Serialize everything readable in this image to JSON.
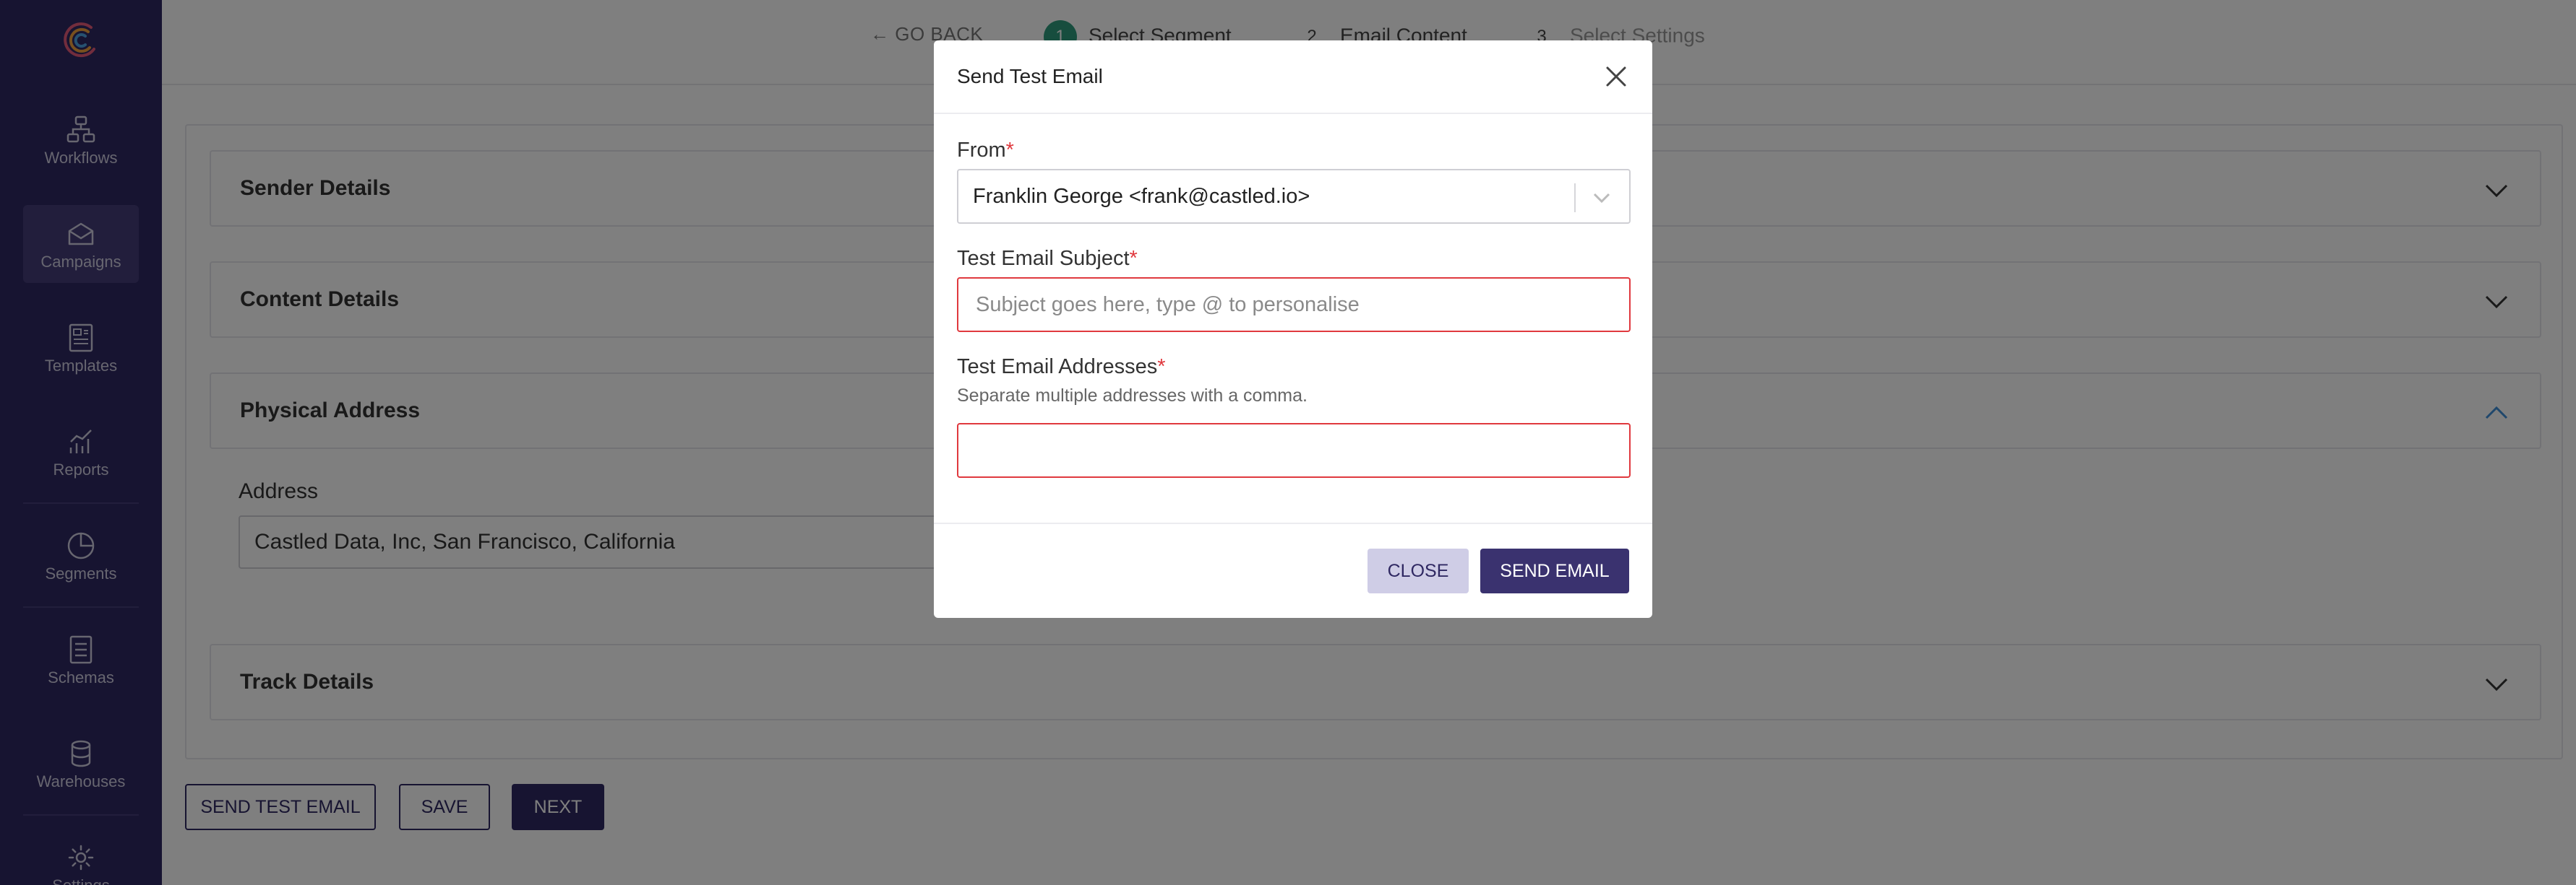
{
  "sidebar": {
    "items": [
      {
        "label": "Workflows",
        "icon": "workflow-icon"
      },
      {
        "label": "Campaigns",
        "icon": "campaign-icon",
        "active": true
      },
      {
        "label": "Templates",
        "icon": "template-icon"
      },
      {
        "label": "Reports",
        "icon": "reports-icon"
      },
      {
        "label": "Segments",
        "icon": "segments-icon"
      },
      {
        "label": "Schemas",
        "icon": "schemas-icon"
      },
      {
        "label": "Warehouses",
        "icon": "warehouse-icon"
      },
      {
        "label": "Settings",
        "icon": "gear-icon"
      }
    ]
  },
  "stepper": {
    "go_back": "GO BACK",
    "steps": [
      {
        "num": "1",
        "label": "Select Segment"
      },
      {
        "num": "2",
        "label": "Email Content"
      },
      {
        "num": "3",
        "label": "Select Settings"
      }
    ]
  },
  "panels": [
    {
      "title": "Sender Details",
      "expanded": false
    },
    {
      "title": "Content Details",
      "expanded": false
    },
    {
      "title": "Physical Address",
      "expanded": true
    },
    {
      "title": "Track Details",
      "expanded": false
    }
  ],
  "address": {
    "label": "Address",
    "value": "Castled Data, Inc, San Francisco, California"
  },
  "actions": {
    "send_test": "SEND TEST EMAIL",
    "save": "SAVE",
    "next": "NEXT"
  },
  "modal": {
    "title": "Send Test Email",
    "from_label": "From",
    "from_value": "Franklin George <frank@castled.io>",
    "subject_label": "Test Email Subject",
    "subject_placeholder": "Subject goes here, type @ to personalise",
    "addresses_label": "Test Email Addresses",
    "addresses_hint": "Separate multiple addresses with a comma.",
    "addresses_value": "",
    "required_mark": "*",
    "close_label": "CLOSE",
    "send_label": "SEND EMAIL"
  },
  "colors": {
    "sidebar": "#2f2862",
    "accent": "#2f2862",
    "step_done": "#2e9b7d",
    "error": "#e0393e"
  }
}
